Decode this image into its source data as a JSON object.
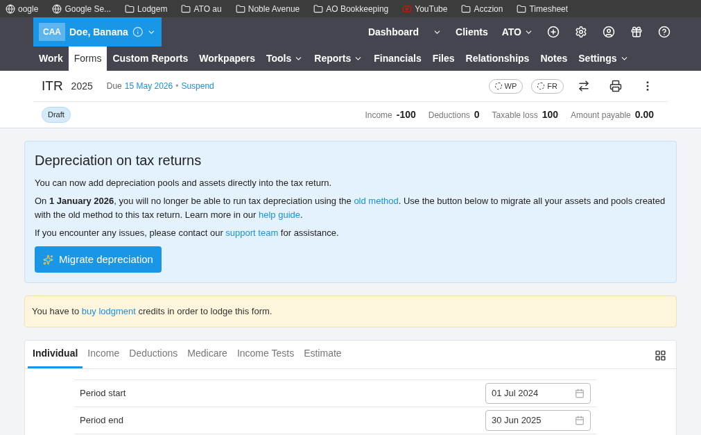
{
  "bookmarks": [
    {
      "label": "oogle",
      "kind": "plain"
    },
    {
      "label": "Google Se...",
      "kind": "plain"
    },
    {
      "label": "Lodgem",
      "kind": "folder"
    },
    {
      "label": "ATO au",
      "kind": "folder"
    },
    {
      "label": "Noble Avenue",
      "kind": "folder"
    },
    {
      "label": "AO Bookkeeping",
      "kind": "folder"
    },
    {
      "label": "YouTube",
      "kind": "video"
    },
    {
      "label": "Acczion",
      "kind": "folder"
    },
    {
      "label": "Timesheet",
      "kind": "folder"
    }
  ],
  "client": {
    "badge": "CAA",
    "name": "Doe, Banana"
  },
  "top_nav": [
    {
      "label": "Dashboard",
      "kind": "link"
    },
    {
      "kind": "caret"
    },
    {
      "label": "Clients",
      "kind": "link"
    },
    {
      "label": "ATO",
      "kind": "dropdown"
    }
  ],
  "nav": [
    {
      "label": "Work",
      "selected": false,
      "dropdown": false
    },
    {
      "label": "Forms",
      "selected": true,
      "dropdown": false
    },
    {
      "label": "Custom Reports",
      "selected": false,
      "dropdown": false
    },
    {
      "label": "Workpapers",
      "selected": false,
      "dropdown": false
    },
    {
      "label": "Tools",
      "selected": false,
      "dropdown": true
    },
    {
      "label": "Reports",
      "selected": false,
      "dropdown": true
    },
    {
      "label": "Financials",
      "selected": false,
      "dropdown": false
    },
    {
      "label": "Files",
      "selected": false,
      "dropdown": false
    },
    {
      "label": "Relationships",
      "selected": false,
      "dropdown": false
    },
    {
      "label": "Notes",
      "selected": false,
      "dropdown": false
    },
    {
      "label": "Settings",
      "selected": false,
      "dropdown": true
    }
  ],
  "form": {
    "type": "ITR",
    "year": "2025",
    "due_label": "Due",
    "due_date": "15 May 2026",
    "separator": "•",
    "suspend": "Suspend",
    "pills": [
      "WP",
      "FR"
    ],
    "status": "Draft"
  },
  "summary": [
    {
      "label": "Income",
      "value": "-100"
    },
    {
      "label": "Deductions",
      "value": "0"
    },
    {
      "label": "Taxable loss",
      "value": "100"
    },
    {
      "label": "Amount payable",
      "value": "0.00"
    }
  ],
  "info_banner": {
    "title": "Depreciation on tax returns",
    "paragraphs": [
      "You can now add depreciation pools and assets directly into the tax return."
    ],
    "p2": {
      "before": "On **1 January 2026**, you will no longer be able to run tax depreciation using the",
      "link1": "old method",
      "middle": ". Use the button below to migrate all your assets and pools created with the old method to this tax return. Learn more in our",
      "link2": "help guide",
      "after": "."
    },
    "p3": {
      "before": "If you encounter any issues, please contact our",
      "link": "support team",
      "after": "for assistance."
    },
    "button": "Migrate depreciation"
  },
  "warning": {
    "before": "You have to",
    "link": "buy lodgment",
    "after": "credits in order to lodge this form."
  },
  "tabs": [
    {
      "label": "Individual",
      "selected": true
    },
    {
      "label": "Income",
      "selected": false
    },
    {
      "label": "Deductions",
      "selected": false
    },
    {
      "label": "Medicare",
      "selected": false
    },
    {
      "label": "Income Tests",
      "selected": false
    },
    {
      "label": "Estimate",
      "selected": false
    }
  ],
  "fields": [
    {
      "label": "Period start",
      "value": "01 Jul 2024"
    },
    {
      "label": "Period end",
      "value": "30 Jun 2025"
    }
  ]
}
